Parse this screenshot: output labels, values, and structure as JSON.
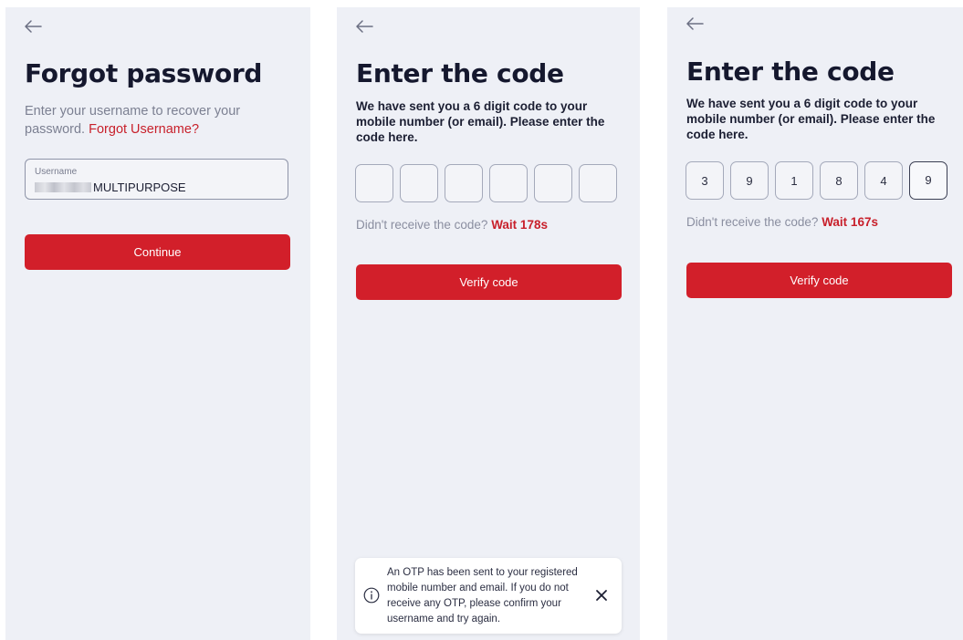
{
  "screens": [
    {
      "title": "Forgot password",
      "subtitle": "Enter your username to recover your password.",
      "subtitle_link": "Forgot Username?",
      "username_field": {
        "label": "Username",
        "value": "MULTIPURPOSE"
      },
      "button_label": "Continue"
    },
    {
      "title": "Enter the code",
      "description": "We have sent you a 6 digit code to your mobile number (or email). Please enter the code here.",
      "code_digits": [
        "",
        "",
        "",
        "",
        "",
        ""
      ],
      "resend_text": "Didn't receive the code?",
      "resend_wait": "Wait 178s",
      "button_label": "Verify code",
      "toast": {
        "message": "An OTP has been sent to your registered mobile number and email. If you do not receive any OTP,  please confirm your username and try again.",
        "info_icon": "info-icon",
        "close_icon": "close-icon"
      }
    },
    {
      "title": "Enter the code",
      "description": "We have sent you a 6 digit code to your mobile number (or email). Please enter the code here.",
      "code_digits": [
        "3",
        "9",
        "1",
        "8",
        "4",
        "9"
      ],
      "resend_text": "Didn't receive the code?",
      "resend_wait": "Wait 167s",
      "button_label": "Verify code"
    }
  ],
  "icons": {
    "back": "back-arrow-icon"
  },
  "colors": {
    "accent": "#d21f2a",
    "link": "#c8202b",
    "panel_bg": "#eef0f6",
    "title": "#15182e"
  }
}
